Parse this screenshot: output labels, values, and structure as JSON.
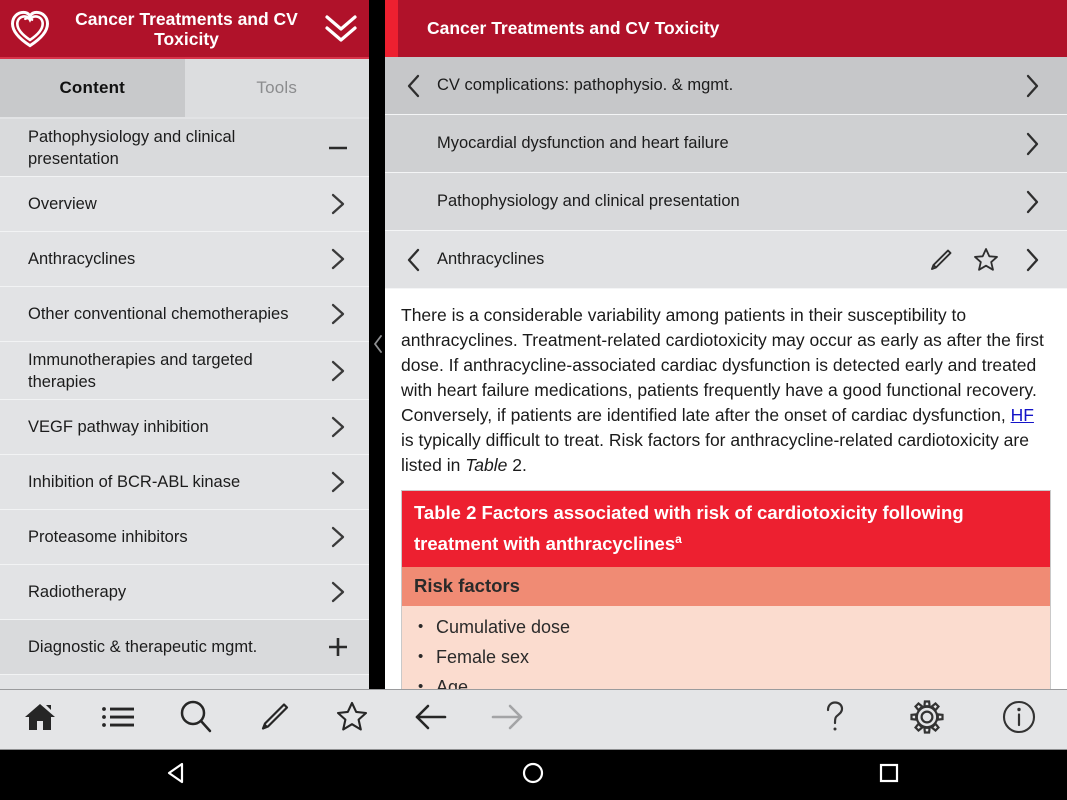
{
  "app": {
    "accent_red_dark": "#b0122a",
    "accent_red_bright": "#ed2030",
    "table_header_bg": "#ed2030",
    "table_subheader_bg": "#f08b74",
    "table_body_bg": "#fbdccf",
    "link_color": "#1414c8"
  },
  "left_panel": {
    "title": "Cancer Treatments and CV Toxicity",
    "logo_icon": "esc-heart-logo-icon",
    "collapse_icon": "chevron-double-down-icon",
    "tabs": [
      {
        "label": "Content",
        "active": true
      },
      {
        "label": "Tools",
        "active": false
      }
    ],
    "toc": [
      {
        "label": "Pathophysiology and clinical presentation",
        "affordance": "minus-icon",
        "type": "group",
        "expanded": true
      },
      {
        "label": "Overview",
        "affordance": "chevron-right-icon",
        "type": "item"
      },
      {
        "label": "Anthracyclines",
        "affordance": "chevron-right-icon",
        "type": "item"
      },
      {
        "label": "Other conventional chemotherapies",
        "affordance": "chevron-right-icon",
        "type": "item"
      },
      {
        "label": "Immunotherapies and targeted therapies",
        "affordance": "chevron-right-icon",
        "type": "item"
      },
      {
        "label": "VEGF pathway inhibition",
        "affordance": "chevron-right-icon",
        "type": "item"
      },
      {
        "label": "Inhibition of BCR-ABL kinase",
        "affordance": "chevron-right-icon",
        "type": "item"
      },
      {
        "label": "Proteasome inhibitors",
        "affordance": "chevron-right-icon",
        "type": "item"
      },
      {
        "label": "Radiotherapy",
        "affordance": "chevron-right-icon",
        "type": "item"
      },
      {
        "label": "Diagnostic & therapeutic mgmt.",
        "affordance": "plus-icon",
        "type": "group",
        "expanded": false
      }
    ]
  },
  "divider": {
    "collapse_icon": "chevron-left-icon"
  },
  "right_panel": {
    "title": "Cancer Treatments and CV Toxicity",
    "breadcrumbs": [
      {
        "label": "CV complications: pathophysio. & mgmt.",
        "back_icon": "chevron-left-icon",
        "forward_icon": "chevron-right-icon",
        "level": 1
      },
      {
        "label": "Myocardial dysfunction and heart failure",
        "back_icon": "",
        "forward_icon": "chevron-right-icon",
        "level": 2
      },
      {
        "label": "Pathophysiology and clinical presentation",
        "back_icon": "",
        "forward_icon": "chevron-right-icon",
        "level": 3
      },
      {
        "label": "Anthracyclines",
        "back_icon": "chevron-left-icon",
        "forward_icon": "chevron-right-icon",
        "level": 4,
        "actions": [
          "pencil-icon",
          "star-outline-icon"
        ]
      }
    ],
    "article": {
      "para_part1": "There is a considerable variability among patients in their susceptibility to anthracyclines. Treatment-related cardiotoxicity may occur as early as after the first dose. If anthracycline-associated cardiac dysfunction is detected early and treated with heart failure medications, patients frequently have a good functional recovery. Conversely, if patients are identified late after the onset of cardiac dysfunction, ",
      "link_text": "HF",
      "para_part2": " is typically difficult to treat. Risk factors for anthracycline-related cardiotoxicity are listed in ",
      "table_ref_italic": "Table",
      "para_part3": " 2."
    },
    "table": {
      "title": "Table 2 Factors associated with risk of cardiotoxicity following treatment with anthracyclines",
      "title_superscript": "a",
      "subheader": "Risk factors",
      "rows": [
        "Cumulative dose",
        "Female sex",
        "Age"
      ]
    }
  },
  "toolbar": {
    "left_buttons": [
      {
        "icon": "home-icon",
        "name": "home-button"
      },
      {
        "icon": "list-icon",
        "name": "table-of-contents-button"
      },
      {
        "icon": "search-icon",
        "name": "search-button"
      },
      {
        "icon": "pencil-icon",
        "name": "annotate-button"
      },
      {
        "icon": "star-outline-icon",
        "name": "favourites-button"
      },
      {
        "icon": "arrow-left-icon",
        "name": "back-button"
      },
      {
        "icon": "arrow-right-icon",
        "name": "forward-button"
      }
    ],
    "right_buttons": [
      {
        "icon": "question-mark-icon",
        "name": "help-button"
      },
      {
        "icon": "gear-icon",
        "name": "settings-button"
      },
      {
        "icon": "info-circle-icon",
        "name": "info-button"
      }
    ]
  },
  "android_nav": {
    "buttons": [
      {
        "icon": "triangle-back-icon",
        "name": "android-back-button"
      },
      {
        "icon": "circle-home-icon",
        "name": "android-home-button"
      },
      {
        "icon": "square-recents-icon",
        "name": "android-recents-button"
      }
    ]
  }
}
